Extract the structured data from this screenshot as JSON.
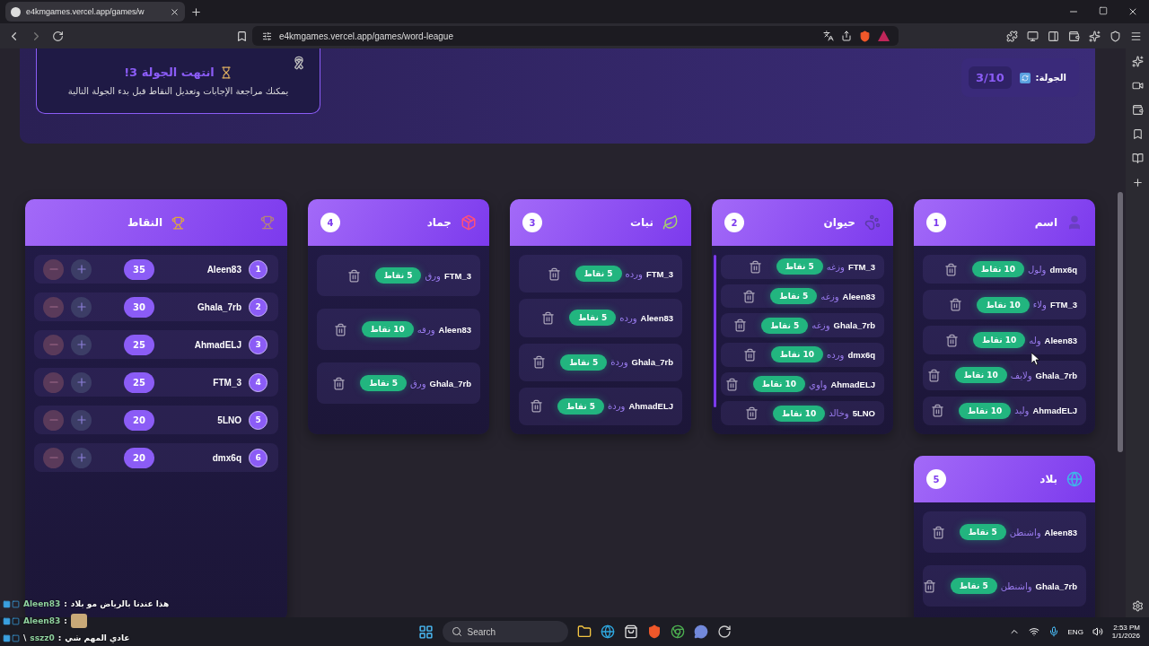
{
  "browser": {
    "tab_title": "e4kmgames.vercel.app/games/w",
    "url": "e4kmgames.vercel.app/games/word-league"
  },
  "banner": {
    "title": "انتهت الجولة 3!",
    "message": "يمكنك مراجعة الإجابات وتعديل النقاط قبل بدء الجولة التالية"
  },
  "round": {
    "label": "الجولة:",
    "value": "3/10"
  },
  "scoreboard": {
    "title": "النقاط",
    "players": [
      {
        "rank": "1",
        "name": "Aleen83",
        "score": "35"
      },
      {
        "rank": "2",
        "name": "Ghala_7rb",
        "score": "30"
      },
      {
        "rank": "3",
        "name": "AhmadELJ",
        "score": "25"
      },
      {
        "rank": "4",
        "name": "FTM_3",
        "score": "25"
      },
      {
        "rank": "5",
        "name": "5LNO",
        "score": "20"
      },
      {
        "rank": "6",
        "name": "dmx6q",
        "score": "20"
      }
    ]
  },
  "categories": [
    {
      "number": "1",
      "title": "اسم",
      "kind": "person",
      "answers": [
        {
          "player": "dmx6q",
          "word": "ولول",
          "points": "10 نقاط"
        },
        {
          "player": "FTM_3",
          "word": "ولاء",
          "points": "10 نقاط"
        },
        {
          "player": "Aleen83",
          "word": "وله",
          "points": "10 نقاط"
        },
        {
          "player": "Ghala_7rb",
          "word": "ولايف",
          "points": "10 نقاط"
        },
        {
          "player": "AhmadELJ",
          "word": "وليد",
          "points": "10 نقاط"
        }
      ]
    },
    {
      "number": "2",
      "title": "حيوان",
      "kind": "animal",
      "answers": [
        {
          "player": "FTM_3",
          "word": "وزغه",
          "points": "5 نقاط"
        },
        {
          "player": "Aleen83",
          "word": "وزغه",
          "points": "5 نقاط"
        },
        {
          "player": "Ghala_7rb",
          "word": "وزغه",
          "points": "5 نقاط"
        },
        {
          "player": "dmx6q",
          "word": "ورده",
          "points": "10 نقاط"
        },
        {
          "player": "AhmadELJ",
          "word": "واوي",
          "points": "10 نقاط"
        },
        {
          "player": "5LNO",
          "word": "وخالد",
          "points": "10 نقاط"
        }
      ]
    },
    {
      "number": "3",
      "title": "نبات",
      "kind": "plant",
      "answers": [
        {
          "player": "FTM_3",
          "word": "ورده",
          "points": "5 نقاط"
        },
        {
          "player": "Aleen83",
          "word": "ورده",
          "points": "5 نقاط"
        },
        {
          "player": "Ghala_7rb",
          "word": "وردة",
          "points": "5 نقاط"
        },
        {
          "player": "AhmadELJ",
          "word": "وردة",
          "points": "5 نقاط"
        }
      ]
    },
    {
      "number": "4",
      "title": "جماد",
      "kind": "object",
      "answers": [
        {
          "player": "FTM_3",
          "word": "ورق",
          "points": "5 نقاط"
        },
        {
          "player": "Aleen83",
          "word": "ورقه",
          "points": "10 نقاط"
        },
        {
          "player": "Ghala_7rb",
          "word": "ورق",
          "points": "5 نقاط"
        }
      ]
    },
    {
      "number": "5",
      "title": "بلاد",
      "kind": "country",
      "answers": [
        {
          "player": "Aleen83",
          "word": "واشنطن",
          "points": "5 نقاط"
        },
        {
          "player": "Ghala_7rb",
          "word": "واشنطن",
          "points": "5 نقاط"
        }
      ]
    }
  ],
  "chat": [
    {
      "kind": "text",
      "user": "Aleen83",
      "separator": ":",
      "message": "هذا عندنا بالرياض مو بلاد"
    },
    {
      "kind": "sticker",
      "user": "Aleen83",
      "separator": ":"
    },
    {
      "kind": "text",
      "prefix": "\\",
      "user": "sszz0",
      "separator": ":",
      "message": "عادي المهم شي"
    }
  ],
  "taskbar": {
    "search": "Search",
    "language": "ENG",
    "time": "2:53 PM",
    "date": "1/1/2026"
  }
}
